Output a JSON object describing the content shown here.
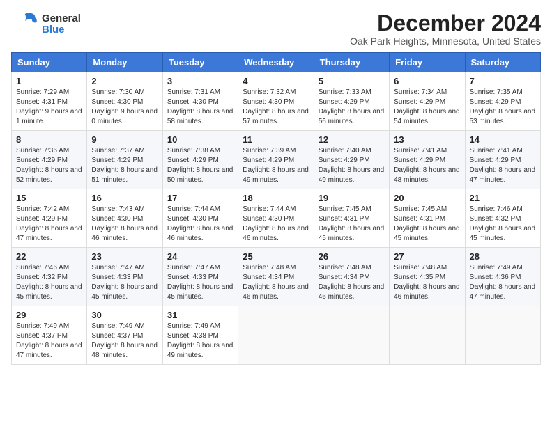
{
  "header": {
    "logo_general": "General",
    "logo_blue": "Blue",
    "title": "December 2024",
    "subtitle": "Oak Park Heights, Minnesota, United States"
  },
  "weekdays": [
    "Sunday",
    "Monday",
    "Tuesday",
    "Wednesday",
    "Thursday",
    "Friday",
    "Saturday"
  ],
  "weeks": [
    [
      {
        "day": "1",
        "sunrise": "Sunrise: 7:29 AM",
        "sunset": "Sunset: 4:31 PM",
        "daylight": "Daylight: 9 hours and 1 minute."
      },
      {
        "day": "2",
        "sunrise": "Sunrise: 7:30 AM",
        "sunset": "Sunset: 4:30 PM",
        "daylight": "Daylight: 9 hours and 0 minutes."
      },
      {
        "day": "3",
        "sunrise": "Sunrise: 7:31 AM",
        "sunset": "Sunset: 4:30 PM",
        "daylight": "Daylight: 8 hours and 58 minutes."
      },
      {
        "day": "4",
        "sunrise": "Sunrise: 7:32 AM",
        "sunset": "Sunset: 4:30 PM",
        "daylight": "Daylight: 8 hours and 57 minutes."
      },
      {
        "day": "5",
        "sunrise": "Sunrise: 7:33 AM",
        "sunset": "Sunset: 4:29 PM",
        "daylight": "Daylight: 8 hours and 56 minutes."
      },
      {
        "day": "6",
        "sunrise": "Sunrise: 7:34 AM",
        "sunset": "Sunset: 4:29 PM",
        "daylight": "Daylight: 8 hours and 54 minutes."
      },
      {
        "day": "7",
        "sunrise": "Sunrise: 7:35 AM",
        "sunset": "Sunset: 4:29 PM",
        "daylight": "Daylight: 8 hours and 53 minutes."
      }
    ],
    [
      {
        "day": "8",
        "sunrise": "Sunrise: 7:36 AM",
        "sunset": "Sunset: 4:29 PM",
        "daylight": "Daylight: 8 hours and 52 minutes."
      },
      {
        "day": "9",
        "sunrise": "Sunrise: 7:37 AM",
        "sunset": "Sunset: 4:29 PM",
        "daylight": "Daylight: 8 hours and 51 minutes."
      },
      {
        "day": "10",
        "sunrise": "Sunrise: 7:38 AM",
        "sunset": "Sunset: 4:29 PM",
        "daylight": "Daylight: 8 hours and 50 minutes."
      },
      {
        "day": "11",
        "sunrise": "Sunrise: 7:39 AM",
        "sunset": "Sunset: 4:29 PM",
        "daylight": "Daylight: 8 hours and 49 minutes."
      },
      {
        "day": "12",
        "sunrise": "Sunrise: 7:40 AM",
        "sunset": "Sunset: 4:29 PM",
        "daylight": "Daylight: 8 hours and 49 minutes."
      },
      {
        "day": "13",
        "sunrise": "Sunrise: 7:41 AM",
        "sunset": "Sunset: 4:29 PM",
        "daylight": "Daylight: 8 hours and 48 minutes."
      },
      {
        "day": "14",
        "sunrise": "Sunrise: 7:41 AM",
        "sunset": "Sunset: 4:29 PM",
        "daylight": "Daylight: 8 hours and 47 minutes."
      }
    ],
    [
      {
        "day": "15",
        "sunrise": "Sunrise: 7:42 AM",
        "sunset": "Sunset: 4:29 PM",
        "daylight": "Daylight: 8 hours and 47 minutes."
      },
      {
        "day": "16",
        "sunrise": "Sunrise: 7:43 AM",
        "sunset": "Sunset: 4:30 PM",
        "daylight": "Daylight: 8 hours and 46 minutes."
      },
      {
        "day": "17",
        "sunrise": "Sunrise: 7:44 AM",
        "sunset": "Sunset: 4:30 PM",
        "daylight": "Daylight: 8 hours and 46 minutes."
      },
      {
        "day": "18",
        "sunrise": "Sunrise: 7:44 AM",
        "sunset": "Sunset: 4:30 PM",
        "daylight": "Daylight: 8 hours and 46 minutes."
      },
      {
        "day": "19",
        "sunrise": "Sunrise: 7:45 AM",
        "sunset": "Sunset: 4:31 PM",
        "daylight": "Daylight: 8 hours and 45 minutes."
      },
      {
        "day": "20",
        "sunrise": "Sunrise: 7:45 AM",
        "sunset": "Sunset: 4:31 PM",
        "daylight": "Daylight: 8 hours and 45 minutes."
      },
      {
        "day": "21",
        "sunrise": "Sunrise: 7:46 AM",
        "sunset": "Sunset: 4:32 PM",
        "daylight": "Daylight: 8 hours and 45 minutes."
      }
    ],
    [
      {
        "day": "22",
        "sunrise": "Sunrise: 7:46 AM",
        "sunset": "Sunset: 4:32 PM",
        "daylight": "Daylight: 8 hours and 45 minutes."
      },
      {
        "day": "23",
        "sunrise": "Sunrise: 7:47 AM",
        "sunset": "Sunset: 4:33 PM",
        "daylight": "Daylight: 8 hours and 45 minutes."
      },
      {
        "day": "24",
        "sunrise": "Sunrise: 7:47 AM",
        "sunset": "Sunset: 4:33 PM",
        "daylight": "Daylight: 8 hours and 45 minutes."
      },
      {
        "day": "25",
        "sunrise": "Sunrise: 7:48 AM",
        "sunset": "Sunset: 4:34 PM",
        "daylight": "Daylight: 8 hours and 46 minutes."
      },
      {
        "day": "26",
        "sunrise": "Sunrise: 7:48 AM",
        "sunset": "Sunset: 4:34 PM",
        "daylight": "Daylight: 8 hours and 46 minutes."
      },
      {
        "day": "27",
        "sunrise": "Sunrise: 7:48 AM",
        "sunset": "Sunset: 4:35 PM",
        "daylight": "Daylight: 8 hours and 46 minutes."
      },
      {
        "day": "28",
        "sunrise": "Sunrise: 7:49 AM",
        "sunset": "Sunset: 4:36 PM",
        "daylight": "Daylight: 8 hours and 47 minutes."
      }
    ],
    [
      {
        "day": "29",
        "sunrise": "Sunrise: 7:49 AM",
        "sunset": "Sunset: 4:37 PM",
        "daylight": "Daylight: 8 hours and 47 minutes."
      },
      {
        "day": "30",
        "sunrise": "Sunrise: 7:49 AM",
        "sunset": "Sunset: 4:37 PM",
        "daylight": "Daylight: 8 hours and 48 minutes."
      },
      {
        "day": "31",
        "sunrise": "Sunrise: 7:49 AM",
        "sunset": "Sunset: 4:38 PM",
        "daylight": "Daylight: 8 hours and 49 minutes."
      },
      null,
      null,
      null,
      null
    ]
  ]
}
